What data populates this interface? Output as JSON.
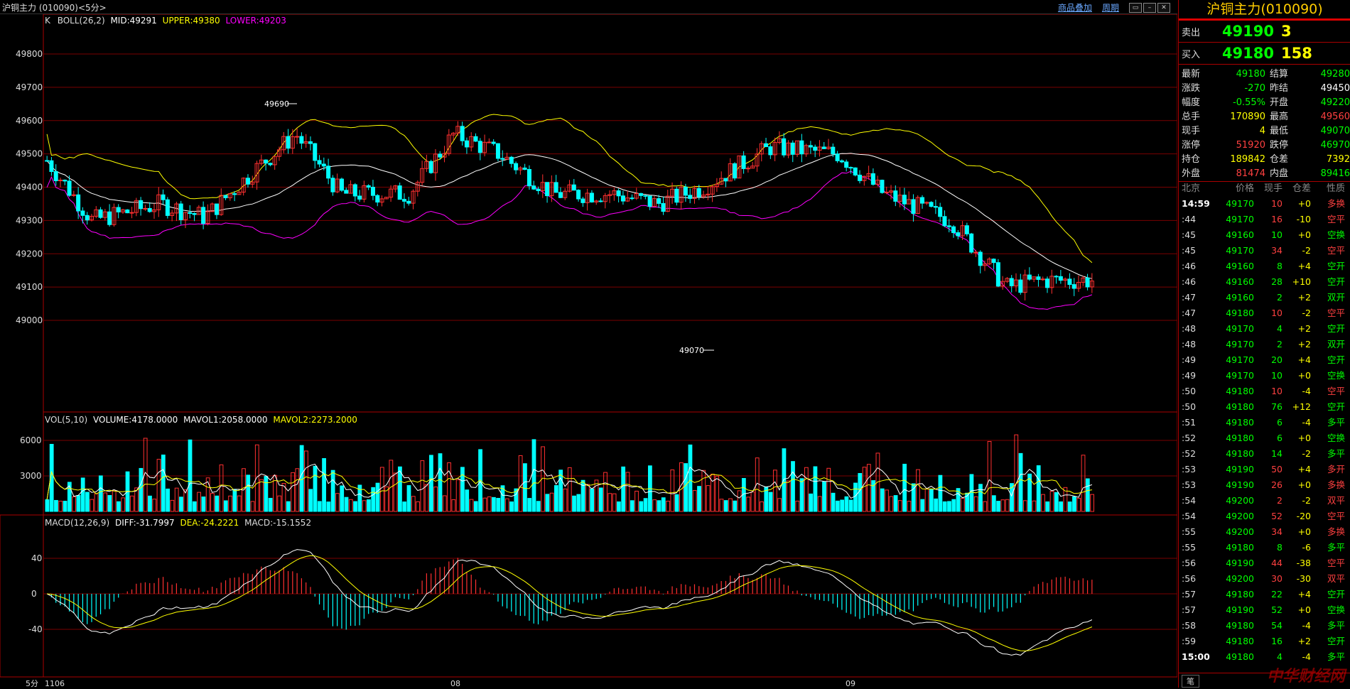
{
  "window": {
    "title": "沪铜主力 (010090)<5分>",
    "link_overlay": "商品叠加",
    "link_period": "周期"
  },
  "kline": {
    "header_prefix": "K",
    "boll_label": "BOLL(26,2)",
    "mid_label": "MID:49291",
    "upper_label": "UPPER:49380",
    "lower_label": "LOWER:49203",
    "high_mark": "49690",
    "low_mark": "49070",
    "y_ticks": [
      "49800",
      "49700",
      "49600",
      "49500",
      "49400",
      "49300",
      "49200",
      "49100",
      "49000"
    ]
  },
  "volume": {
    "header": "VOL(5,10)",
    "volume_label": "VOLUME:4178.0000",
    "mavol1_label": "MAVOL1:2058.0000",
    "mavol2_label": "MAVOL2:2273.2000",
    "y_ticks": [
      "6000",
      "3000"
    ]
  },
  "macd": {
    "header": "MACD(12,26,9)",
    "diff_label": "DIFF:-31.7997",
    "dea_label": "DEA:-24.2221",
    "macd_label": "MACD:-15.1552",
    "y_ticks": [
      "40",
      "0",
      "-40"
    ]
  },
  "x_axis": {
    "period_label": "5分",
    "labels": [
      "1106",
      "08",
      "09"
    ]
  },
  "quote": {
    "title": "沪铜主力(010090)",
    "sell_label": "卖出",
    "sell_price": "49190",
    "sell_vol": "3",
    "buy_label": "买入",
    "buy_price": "49180",
    "buy_vol": "158",
    "stats": [
      {
        "k": "最新",
        "v": "49180",
        "vc": "green",
        "k2": "结算",
        "v2": "49280",
        "v2c": "green"
      },
      {
        "k": "涨跌",
        "v": "-270",
        "vc": "green",
        "k2": "昨结",
        "v2": "49450",
        "v2c": "white"
      },
      {
        "k": "幅度",
        "v": "-0.55%",
        "vc": "green",
        "k2": "开盘",
        "v2": "49220",
        "v2c": "green"
      },
      {
        "k": "总手",
        "v": "170890",
        "vc": "yellow",
        "k2": "最高",
        "v2": "49560",
        "v2c": "red"
      },
      {
        "k": "现手",
        "v": "4",
        "vc": "yellow",
        "k2": "最低",
        "v2": "49070",
        "v2c": "green"
      },
      {
        "k": "涨停",
        "v": "51920",
        "vc": "red",
        "k2": "跌停",
        "v2": "46970",
        "v2c": "green"
      },
      {
        "k": "持仓",
        "v": "189842",
        "vc": "yellow",
        "k2": "仓差",
        "v2": "7392",
        "v2c": "yellow"
      },
      {
        "k": "外盘",
        "v": "81474",
        "vc": "red",
        "k2": "内盘",
        "v2": "89416",
        "v2c": "green"
      }
    ],
    "tick_headers": [
      "北京",
      "价格",
      "现手",
      "仓差",
      "性质"
    ],
    "ticks": [
      {
        "t": "14:59",
        "p": "49170",
        "v": "10",
        "d": "+0",
        "n": "多换",
        "nc": "red"
      },
      {
        "t": ":44",
        "p": "49170",
        "v": "16",
        "d": "-10",
        "n": "空平",
        "nc": "red"
      },
      {
        "t": ":45",
        "p": "49160",
        "v": "10",
        "d": "+0",
        "n": "空换",
        "nc": "green"
      },
      {
        "t": ":45",
        "p": "49170",
        "v": "34",
        "d": "-2",
        "n": "空平",
        "nc": "red"
      },
      {
        "t": ":46",
        "p": "49160",
        "v": "8",
        "d": "+4",
        "n": "空开",
        "nc": "green"
      },
      {
        "t": ":46",
        "p": "49160",
        "v": "28",
        "d": "+10",
        "n": "空开",
        "nc": "green"
      },
      {
        "t": ":47",
        "p": "49160",
        "v": "2",
        "d": "+2",
        "n": "双开",
        "nc": "green"
      },
      {
        "t": ":47",
        "p": "49180",
        "v": "10",
        "d": "-2",
        "n": "空平",
        "nc": "red"
      },
      {
        "t": ":48",
        "p": "49170",
        "v": "4",
        "d": "+2",
        "n": "空开",
        "nc": "green"
      },
      {
        "t": ":48",
        "p": "49170",
        "v": "2",
        "d": "+2",
        "n": "双开",
        "nc": "green"
      },
      {
        "t": ":49",
        "p": "49170",
        "v": "20",
        "d": "+4",
        "n": "空开",
        "nc": "green"
      },
      {
        "t": ":49",
        "p": "49170",
        "v": "10",
        "d": "+0",
        "n": "空换",
        "nc": "green"
      },
      {
        "t": ":50",
        "p": "49180",
        "v": "10",
        "d": "-4",
        "n": "空平",
        "nc": "red"
      },
      {
        "t": ":50",
        "p": "49180",
        "v": "76",
        "d": "+12",
        "n": "空开",
        "nc": "green"
      },
      {
        "t": ":51",
        "p": "49180",
        "v": "6",
        "d": "-4",
        "n": "多平",
        "nc": "green"
      },
      {
        "t": ":52",
        "p": "49180",
        "v": "6",
        "d": "+0",
        "n": "空换",
        "nc": "green"
      },
      {
        "t": ":52",
        "p": "49180",
        "v": "14",
        "d": "-2",
        "n": "多平",
        "nc": "green"
      },
      {
        "t": ":53",
        "p": "49190",
        "v": "50",
        "d": "+4",
        "n": "多开",
        "nc": "red"
      },
      {
        "t": ":53",
        "p": "49190",
        "v": "26",
        "d": "+0",
        "n": "多换",
        "nc": "red"
      },
      {
        "t": ":54",
        "p": "49200",
        "v": "2",
        "d": "-2",
        "n": "双平",
        "nc": "red"
      },
      {
        "t": ":54",
        "p": "49200",
        "v": "52",
        "d": "-20",
        "n": "空平",
        "nc": "red"
      },
      {
        "t": ":55",
        "p": "49200",
        "v": "34",
        "d": "+0",
        "n": "多换",
        "nc": "red"
      },
      {
        "t": ":55",
        "p": "49180",
        "v": "8",
        "d": "-6",
        "n": "多平",
        "nc": "green"
      },
      {
        "t": ":56",
        "p": "49190",
        "v": "44",
        "d": "-38",
        "n": "空平",
        "nc": "red"
      },
      {
        "t": ":56",
        "p": "49200",
        "v": "30",
        "d": "-30",
        "n": "双平",
        "nc": "red"
      },
      {
        "t": ":57",
        "p": "49180",
        "v": "22",
        "d": "+4",
        "n": "空开",
        "nc": "green"
      },
      {
        "t": ":57",
        "p": "49190",
        "v": "52",
        "d": "+0",
        "n": "空换",
        "nc": "green"
      },
      {
        "t": ":58",
        "p": "49180",
        "v": "54",
        "d": "-4",
        "n": "多平",
        "nc": "green"
      },
      {
        "t": ":59",
        "p": "49180",
        "v": "16",
        "d": "+2",
        "n": "空开",
        "nc": "green"
      },
      {
        "t": "15:00",
        "p": "49180",
        "v": "4",
        "d": "-4",
        "n": "多平",
        "nc": "green"
      }
    ],
    "tab_label": "笔",
    "watermark": "中华财经网"
  },
  "colors": {
    "up": "#ff3030",
    "down": "#00ffff",
    "boll_mid": "#ffffff",
    "boll_upper": "#ffff00",
    "boll_lower": "#ff00ff",
    "grid": "#8b0000"
  }
}
